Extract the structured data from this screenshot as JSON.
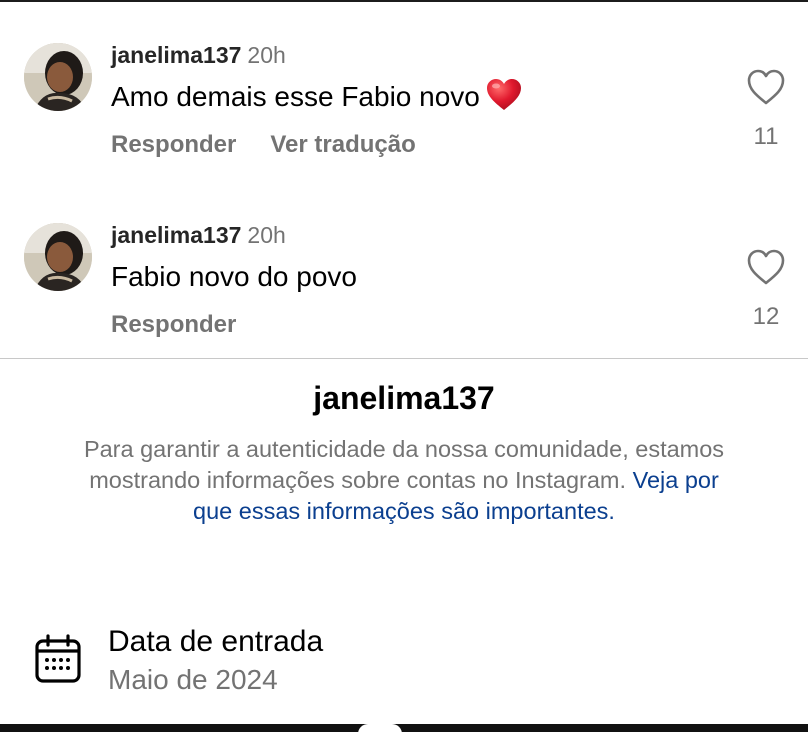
{
  "comments": [
    {
      "username": "janelima137",
      "time": "20h",
      "text": "Amo demais esse Fabio novo",
      "emoji": "red-heart",
      "actions": [
        "Responder",
        "Ver tradução"
      ],
      "likes": "11",
      "avatar_icon": "profile-photo"
    },
    {
      "username": "janelima137",
      "time": "20h",
      "text": "Fabio novo do povo",
      "actions": [
        "Responder"
      ],
      "likes": "12",
      "avatar_icon": "profile-photo"
    }
  ],
  "about": {
    "title": "janelima137",
    "description": "Para garantir a autenticidade da nossa comunidade, estamos mostrando informações sobre contas no Instagram.",
    "link": "Veja por que essas informações são importantes."
  },
  "joined": {
    "icon": "calendar-icon",
    "label": "Data de entrada",
    "value": "Maio de 2024"
  },
  "colors": {
    "secondary_text": "#737373",
    "link": "#0b3f8f",
    "emoji_heart": "#e0182d"
  }
}
